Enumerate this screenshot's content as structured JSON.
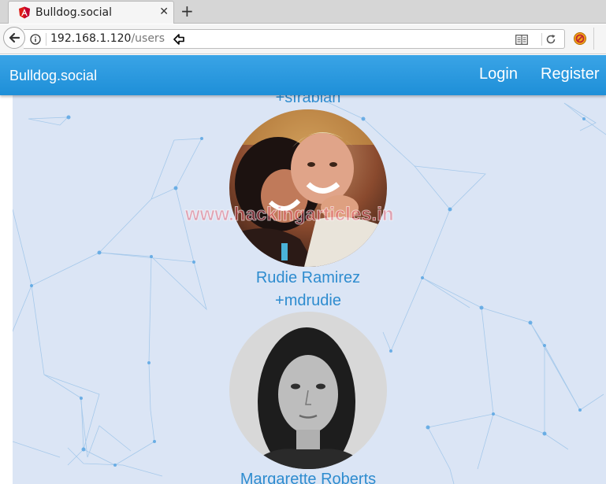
{
  "browser": {
    "tab_title": "Bulldog.social",
    "url_host": "192.168.1.120",
    "url_path": "/users"
  },
  "site": {
    "brand": "Bulldog.social",
    "nav": {
      "login": "Login",
      "register": "Register"
    }
  },
  "users": [
    {
      "handle": "+sfrabian"
    },
    {
      "name": "Rudie Ramirez",
      "handle": "+mdrudie"
    },
    {
      "name": "Margarette Roberts"
    }
  ],
  "watermark": "www.hackingarticles.in",
  "colors": {
    "header": "#1e8fd8",
    "content_bg": "#dbe5f5",
    "link": "#2e8ccf"
  }
}
